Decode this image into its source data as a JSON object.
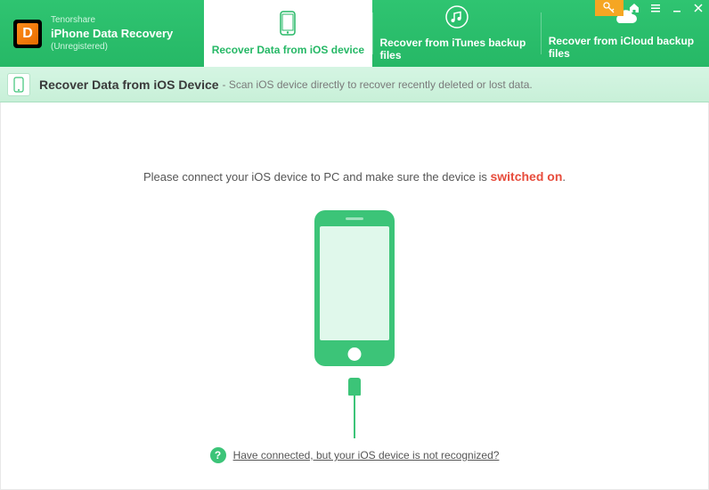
{
  "brand": {
    "company": "Tenorshare",
    "product": "iPhone Data Recovery",
    "status": "(Unregistered)",
    "iconLetter": "D"
  },
  "tabs": [
    {
      "label": "Recover Data from iOS device"
    },
    {
      "label": "Recover from iTunes backup files"
    },
    {
      "label": "Recover from iCloud backup files"
    }
  ],
  "subheader": {
    "title": "Recover Data from iOS Device",
    "desc": " - Scan iOS device directly to recover recently deleted or lost data."
  },
  "content": {
    "connectMsgPrefix": "Please connect your iOS device to PC and make sure the device is ",
    "connectMsgHighlight": "switched on",
    "connectMsgSuffix": "."
  },
  "footer": {
    "helpGlyph": "?",
    "linkText": "Have connected, but your iOS device is not recognized?"
  }
}
